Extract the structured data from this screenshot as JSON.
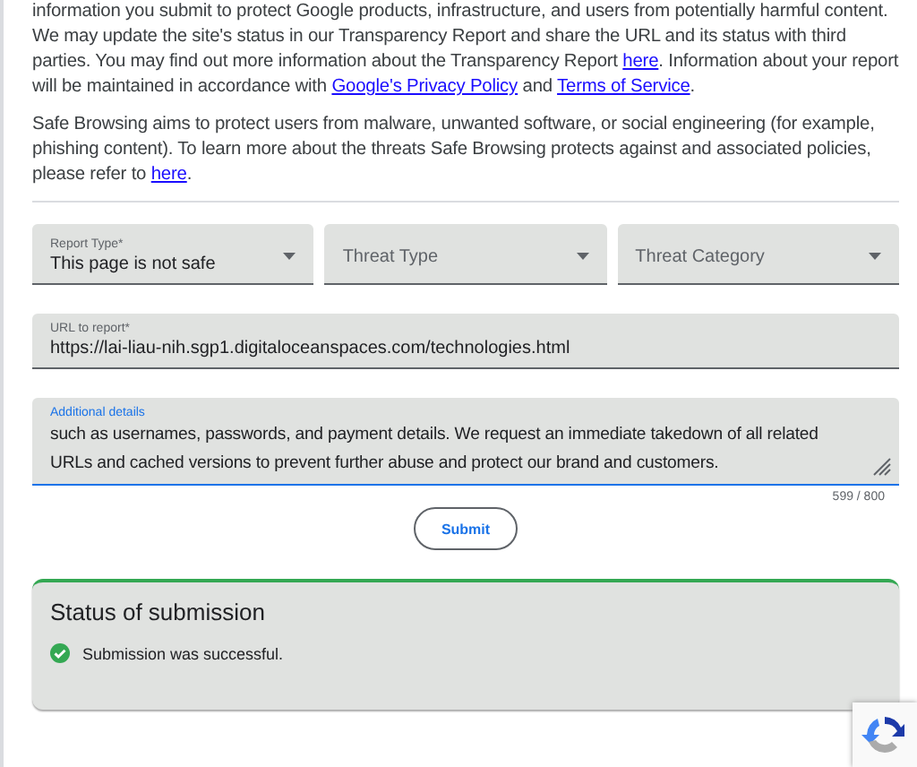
{
  "intro": [
    [
      {
        "text": "information you submit to protect Google products, infrastructure, and users from potentially harmful content. We may update the site's status in our Transparency Report and share the URL and its status with third parties. You may find out more information about the Transparency Report "
      },
      {
        "link": "here"
      },
      {
        "text": ". Information about your report will be maintained in accordance with "
      },
      {
        "link": "Google's Privacy Policy"
      },
      {
        "text": " and "
      },
      {
        "link": "Terms of Service"
      },
      {
        "text": "."
      }
    ],
    [
      {
        "text": "Safe Browsing aims to protect users from malware, unwanted software, or social engineering (for example, phishing content). To learn more about the threats Safe Browsing protects against and associated policies, please refer to "
      },
      {
        "link": "here"
      },
      {
        "text": "."
      }
    ]
  ],
  "dropdowns": [
    {
      "label": "Report Type*",
      "value": "This page is not safe"
    },
    {
      "placeholder": "Threat Type"
    },
    {
      "placeholder": "Threat Category"
    }
  ],
  "url_field": {
    "label": "URL to report*",
    "value": "https://lai-liau-nih.sgp1.digitaloceanspaces.com/technologies.html",
    "focused": false
  },
  "details_field": {
    "label": "Additional details",
    "value": "such as usernames, passwords, and payment details. We request an immediate takedown of all related URLs and cached versions to prevent further abuse and protect our brand and customers.",
    "focused": true,
    "counter": "599 / 800"
  },
  "submit": "Submit",
  "status": {
    "title": "Status of submission",
    "message": "Submission was successful.",
    "success": true
  }
}
